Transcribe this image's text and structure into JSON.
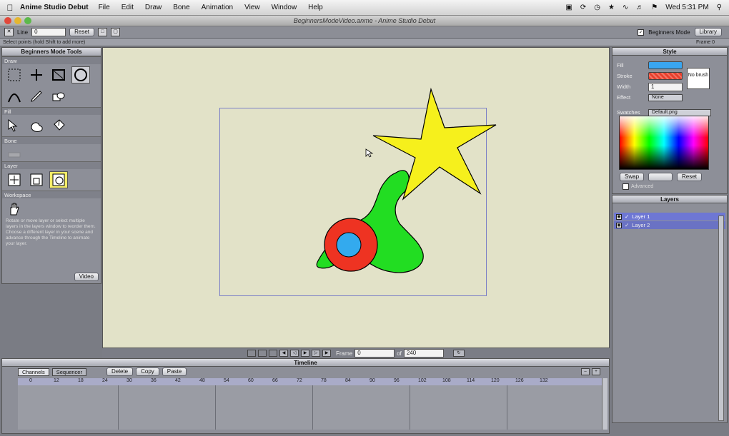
{
  "menubar": {
    "app_name": "Anime Studio Debut",
    "items": [
      "File",
      "Edit",
      "Draw",
      "Bone",
      "Animation",
      "View",
      "Window",
      "Help"
    ],
    "clock": "Wed 5:31 PM"
  },
  "window": {
    "title": "BeginnersModeVideo.anme - Anime Studio Debut"
  },
  "toolopts": {
    "line_label": "Line",
    "line_value": "0",
    "reset_label": "Reset",
    "beginners_mode_label": "Beginners Mode",
    "library_label": "Library"
  },
  "hint": {
    "text": "Select points (hold Shift to add more)",
    "frame": "Frame 0"
  },
  "tools": {
    "title": "Beginners Mode Tools",
    "sections": {
      "draw": "Draw",
      "fill": "Fill",
      "bone": "Bone",
      "layer": "Layer",
      "workspace": "Workspace"
    },
    "description": "Rotate or move layer or select multiple layers in the layers window to reorder them. Choose a different layer in your scene and advance through the Timeline to animate your layer.",
    "video_label": "Video"
  },
  "playback": {
    "frame_label": "Frame",
    "frame_value": "0",
    "of_label": "of",
    "end_value": "240"
  },
  "timeline": {
    "title": "Timeline",
    "tabs": [
      "Channels",
      "Sequencer"
    ],
    "actions": [
      "Delete",
      "Copy",
      "Paste"
    ],
    "ruler": [
      "0",
      "12",
      "18",
      "24",
      "30",
      "36",
      "42",
      "48",
      "54",
      "60",
      "66",
      "72",
      "78",
      "84",
      "90",
      "96",
      "102",
      "108",
      "114",
      "120",
      "126",
      "132"
    ]
  },
  "style": {
    "title": "Style",
    "fill_label": "Fill",
    "stroke_label": "Stroke",
    "width_label": "Width",
    "width_value": "1",
    "effect_label": "Effect",
    "effect_value": "None",
    "no_brush_label": "No brush",
    "swatches_label": "Swatches",
    "swatches_value": "Default.png",
    "swap_label": "Swap",
    "reset_label": "Reset",
    "advanced_label": "Advanced",
    "fill_color": "#3aa6f0",
    "stroke_color": "#e8402e"
  },
  "layers": {
    "title": "Layers",
    "items": [
      {
        "name": "Layer 1",
        "selected": true
      },
      {
        "name": "Layer 2",
        "selected": false
      }
    ]
  }
}
